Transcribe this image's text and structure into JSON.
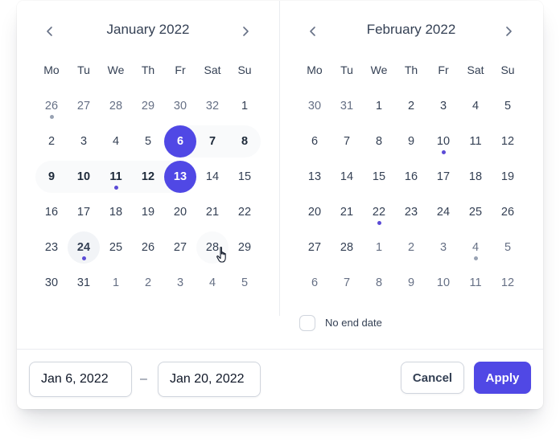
{
  "colors": {
    "accent": "#5048e5",
    "range_band": "#f9fafb",
    "event_dot": "#5b4bd6",
    "muted_dot": "#98a2b3"
  },
  "weekdays": [
    "Mo",
    "Tu",
    "We",
    "Th",
    "Fr",
    "Sat",
    "Su"
  ],
  "months": [
    {
      "title": "January 2022",
      "prev_icon": "chevron-left-icon",
      "next_icon": "chevron-right-icon",
      "weeks": [
        [
          {
            "d": "26",
            "muted": true,
            "dot": "gray"
          },
          {
            "d": "27",
            "muted": true
          },
          {
            "d": "28",
            "muted": true
          },
          {
            "d": "29",
            "muted": true
          },
          {
            "d": "30",
            "muted": true
          },
          {
            "d": "32",
            "muted": true
          },
          {
            "d": "1"
          }
        ],
        [
          {
            "d": "2"
          },
          {
            "d": "3"
          },
          {
            "d": "4"
          },
          {
            "d": "5"
          },
          {
            "d": "6",
            "state": "selected"
          },
          {
            "d": "7",
            "state": "inrange"
          },
          {
            "d": "8",
            "state": "inrange"
          }
        ],
        [
          {
            "d": "9",
            "state": "inrange"
          },
          {
            "d": "10",
            "state": "inrange"
          },
          {
            "d": "11",
            "state": "inrange",
            "dot": "purple"
          },
          {
            "d": "12",
            "state": "inrange"
          },
          {
            "d": "13",
            "state": "selected"
          },
          {
            "d": "14"
          },
          {
            "d": "15"
          }
        ],
        [
          {
            "d": "16"
          },
          {
            "d": "17"
          },
          {
            "d": "18"
          },
          {
            "d": "19"
          },
          {
            "d": "20"
          },
          {
            "d": "21"
          },
          {
            "d": "22"
          }
        ],
        [
          {
            "d": "23"
          },
          {
            "d": "24",
            "state": "today",
            "dot": "purple"
          },
          {
            "d": "25"
          },
          {
            "d": "26"
          },
          {
            "d": "27"
          },
          {
            "d": "28",
            "state": "hover"
          },
          {
            "d": "29"
          }
        ],
        [
          {
            "d": "30"
          },
          {
            "d": "31"
          },
          {
            "d": "1",
            "muted": true
          },
          {
            "d": "2",
            "muted": true
          },
          {
            "d": "3",
            "muted": true
          },
          {
            "d": "4",
            "muted": true
          },
          {
            "d": "5",
            "muted": true
          }
        ]
      ]
    },
    {
      "title": "February 2022",
      "prev_icon": "chevron-left-icon",
      "next_icon": "chevron-right-icon",
      "weeks": [
        [
          {
            "d": "30",
            "muted": true
          },
          {
            "d": "31",
            "muted": true
          },
          {
            "d": "1"
          },
          {
            "d": "2"
          },
          {
            "d": "3"
          },
          {
            "d": "4"
          },
          {
            "d": "5"
          }
        ],
        [
          {
            "d": "6"
          },
          {
            "d": "7"
          },
          {
            "d": "8"
          },
          {
            "d": "9"
          },
          {
            "d": "10",
            "dot": "purple"
          },
          {
            "d": "11"
          },
          {
            "d": "12"
          }
        ],
        [
          {
            "d": "13"
          },
          {
            "d": "14"
          },
          {
            "d": "15"
          },
          {
            "d": "16"
          },
          {
            "d": "17"
          },
          {
            "d": "18"
          },
          {
            "d": "19"
          }
        ],
        [
          {
            "d": "20"
          },
          {
            "d": "21"
          },
          {
            "d": "22",
            "dot": "purple"
          },
          {
            "d": "23"
          },
          {
            "d": "24"
          },
          {
            "d": "25"
          },
          {
            "d": "26"
          }
        ],
        [
          {
            "d": "27"
          },
          {
            "d": "28"
          },
          {
            "d": "1",
            "muted": true
          },
          {
            "d": "2",
            "muted": true
          },
          {
            "d": "3",
            "muted": true
          },
          {
            "d": "4",
            "muted": true,
            "dot": "gray"
          },
          {
            "d": "5",
            "muted": true
          }
        ],
        [
          {
            "d": "6",
            "muted": true
          },
          {
            "d": "7",
            "muted": true
          },
          {
            "d": "8",
            "muted": true
          },
          {
            "d": "9",
            "muted": true
          },
          {
            "d": "10",
            "muted": true
          },
          {
            "d": "11",
            "muted": true
          },
          {
            "d": "12",
            "muted": true
          }
        ]
      ]
    }
  ],
  "no_end_date": {
    "label": "No end date",
    "checked": false
  },
  "start_date": {
    "value": "Jan 6, 2022"
  },
  "range_separator": "–",
  "end_date": {
    "value": "Jan 20, 2022"
  },
  "buttons": {
    "cancel": "Cancel",
    "apply": "Apply"
  },
  "cursor_icon": "hand-pointer-icon"
}
